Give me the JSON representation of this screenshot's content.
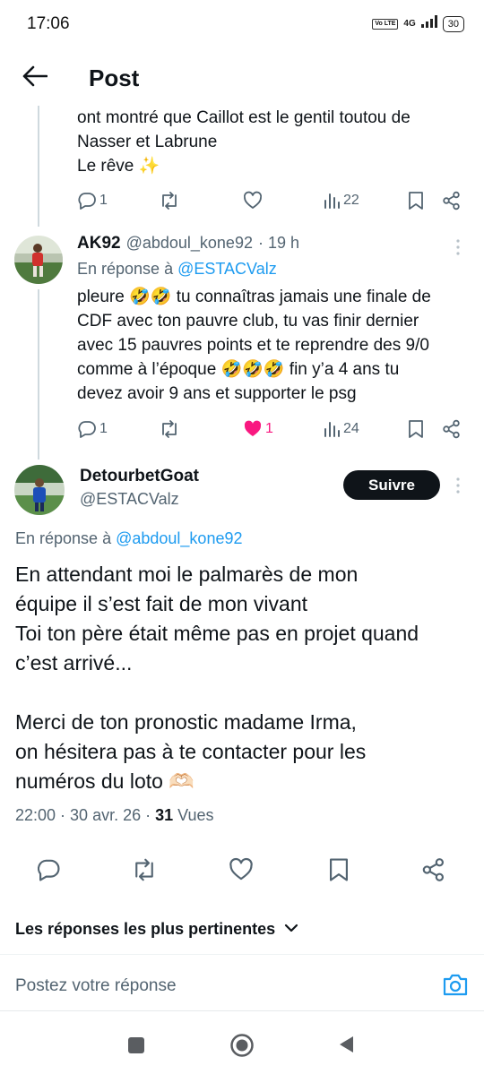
{
  "status_bar": {
    "time": "17:06",
    "volte": "Vo LTE",
    "network": "4G",
    "battery": "30"
  },
  "header": {
    "title": "Post"
  },
  "prev_tweet": {
    "lines": [
      "ont montré que Caillot est le gentil toutou de",
      "Nasser et Labrune",
      "Le rêve ✨"
    ],
    "replies": "1",
    "views": "22"
  },
  "reply_tweet": {
    "name": "AK92",
    "handle": "@abdoul_kone92",
    "time": "· 19 h",
    "reply_prefix": "En réponse à",
    "reply_to": "@ESTACValz",
    "lines": [
      "pleure 🤣🤣 tu connaîtras jamais une finale de",
      "CDF avec ton pauvre club, tu vas finir dernier",
      "avec 15 pauvres points et te reprendre des 9/0",
      "comme à l’époque 🤣🤣🤣 fin y’a 4 ans tu",
      "devez avoir 9 ans et supporter le psg"
    ],
    "replies": "1",
    "likes": "1",
    "views": "24"
  },
  "main_tweet": {
    "name": "DetourbetGoat",
    "handle": "@ESTACValz",
    "follow_label": "Suivre",
    "reply_prefix": "En réponse à",
    "reply_to": "@abdoul_kone92",
    "lines": [
      "En attendant moi le palmarès de mon",
      "équipe il s’est fait de mon vivant",
      "Toi ton père était même pas en projet quand",
      "c’est arrivé...",
      "",
      "Merci de ton pronostic madame Irma,",
      "on hésitera pas à te contacter pour les",
      "numéros du loto 🫶🏻"
    ],
    "timestamp": "22:00 · 30 avr. 26 ·",
    "views_count": "31",
    "views_label": "Vues"
  },
  "sort": {
    "label": "Les réponses les plus pertinentes"
  },
  "composer": {
    "placeholder": "Postez votre réponse"
  },
  "colors": {
    "accent": "#1d9bf0",
    "like": "#f91880",
    "muted": "#536471"
  }
}
